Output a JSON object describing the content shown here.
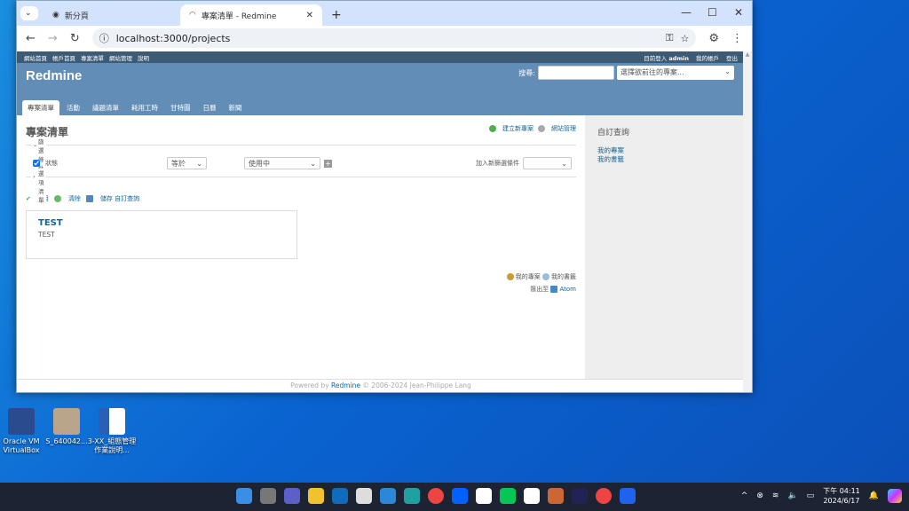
{
  "desktop": {
    "icons": [
      {
        "label": "Oracle VM VirtualBox"
      },
      {
        "label": "S_640042..."
      },
      {
        "label": "3-XX_組態管理作業說明..."
      }
    ]
  },
  "browser": {
    "tabs": [
      {
        "label": "新分頁",
        "active": false
      },
      {
        "label": "專案清單 - Redmine",
        "active": true
      }
    ],
    "new_tab": "+",
    "url": "localhost:3000/projects"
  },
  "redmine": {
    "top_menu": [
      "網站首頁",
      "帳戶首頁",
      "專案清單",
      "網站管理",
      "說明"
    ],
    "logged_in_prefix": "目前登入",
    "user": "admin",
    "my_account": "我的帳戶",
    "logout": "登出",
    "app_title": "Redmine",
    "search_label": "搜尋:",
    "search_value": "",
    "project_jump": "選擇欲前往的專案...",
    "main_tabs": [
      {
        "label": "專案清單",
        "selected": true
      },
      {
        "label": "活動"
      },
      {
        "label": "議題清單"
      },
      {
        "label": "耗用工時"
      },
      {
        "label": "甘特圖"
      },
      {
        "label": "日曆"
      },
      {
        "label": "新聞"
      }
    ],
    "page_title": "專案清單",
    "new_project": "建立新專案",
    "admin": "網站管理",
    "filters_legend": "篩選條件",
    "filter_field": "狀態",
    "filter_checked": true,
    "filter_operator": "等於",
    "filter_value": "使用中",
    "add_filter_label": "加入新篩選條件",
    "add_filter_value": "",
    "options_legend": "選項清單",
    "apply": "套用",
    "clear": "清除",
    "save_query": "儲存 自訂查詢",
    "projects": [
      {
        "name": "TEST",
        "description": "TEST"
      }
    ],
    "my_projects": "我的專案",
    "my_bookmarks": "我的書籤",
    "export_label": "匯出至",
    "atom": "Atom",
    "sidebar_title": "自訂查詢",
    "sidebar_links": [
      "我的專案",
      "我的書籤"
    ],
    "footer_prefix": "Powered by",
    "footer_link": "Redmine",
    "footer_suffix": "© 2006-2024 Jean-Philippe Lang"
  },
  "taskbar": {
    "time": "下午 04:11",
    "date": "2024/6/17"
  }
}
